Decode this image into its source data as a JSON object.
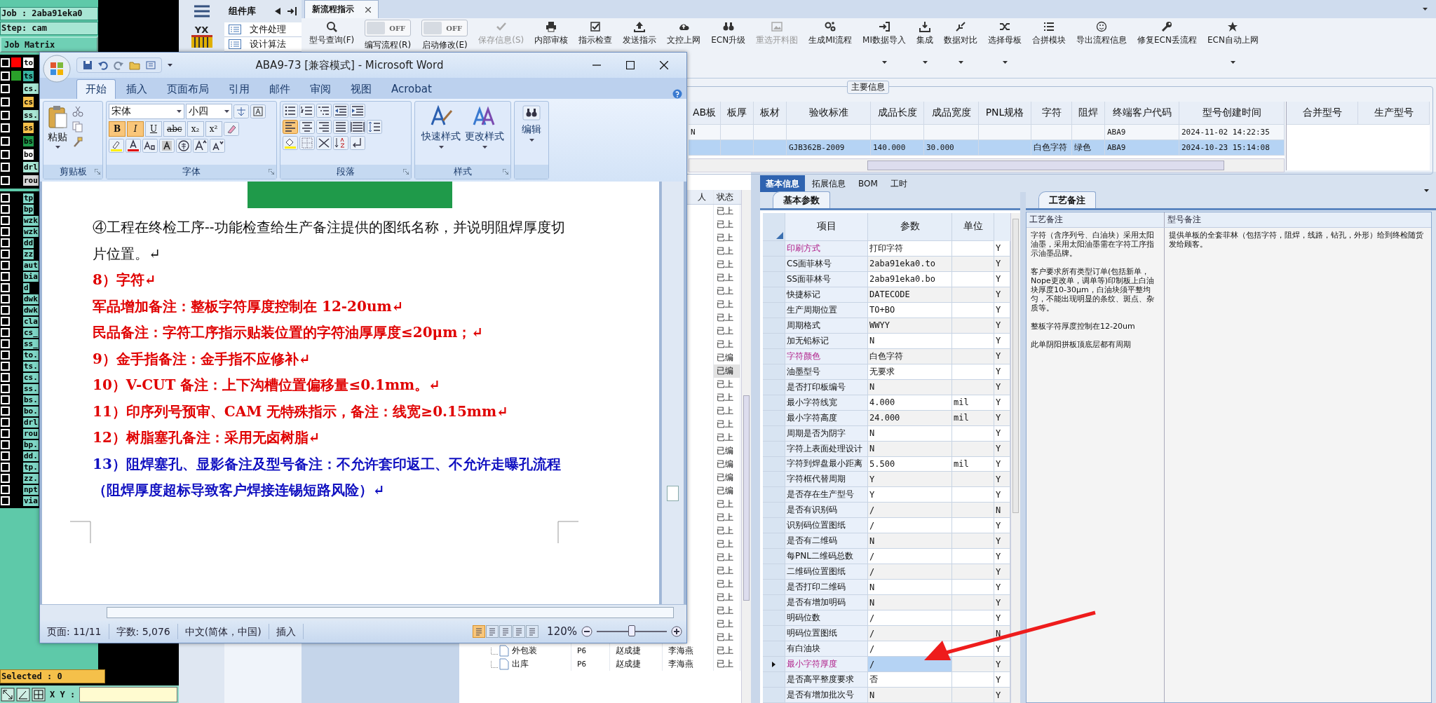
{
  "cam_panel": {
    "job": "Job : 2aba91eka0",
    "step": "Step: cam",
    "matrix_button": "Job Matrix",
    "layers": [
      {
        "name": "to",
        "color": "#ffffff",
        "checked": false,
        "marker": {
          "color": "#ff0000"
        }
      },
      {
        "name": "ts",
        "color": "#36b3a0",
        "checked": false,
        "marker": {
          "color": "#2aa02a"
        }
      },
      {
        "name": "cs.",
        "color": "#a8e6d4",
        "checked": false
      },
      {
        "name": "cs",
        "color": "#f5c04a",
        "checked": false
      },
      {
        "name": "ss.",
        "color": "#a8e6d4",
        "checked": false
      },
      {
        "name": "ss",
        "color": "#f5c04a",
        "checked": false
      },
      {
        "name": "bs",
        "color": "#1f9a4a",
        "checked": false
      },
      {
        "name": "bo",
        "color": "#ffffff",
        "checked": false
      },
      {
        "name": "drl",
        "color": "#a8e6d4",
        "checked": false
      },
      {
        "name": "rou",
        "color": "#d8d8d8",
        "checked": false
      }
    ],
    "layers_lower": [
      {
        "name": "tp",
        "checked": false
      },
      {
        "name": "bp",
        "checked": false
      },
      {
        "name": "wzk",
        "checked": false
      },
      {
        "name": "wzk",
        "checked": false
      },
      {
        "name": "dd",
        "checked": false
      },
      {
        "name": "zz",
        "checked": false
      },
      {
        "name": "aut",
        "checked": false
      },
      {
        "name": "bia",
        "checked": false
      },
      {
        "name": "d",
        "checked": false
      },
      {
        "name": "dwk",
        "checked": false
      },
      {
        "name": "dwk",
        "checked": false
      },
      {
        "name": "cla",
        "checked": false
      },
      {
        "name": "cs_",
        "checked": false
      },
      {
        "name": "ss_",
        "checked": false
      },
      {
        "name": "to.",
        "checked": false
      },
      {
        "name": "ts.",
        "checked": false
      },
      {
        "name": "cs.",
        "checked": false
      },
      {
        "name": "ss.",
        "checked": false
      },
      {
        "name": "bs.",
        "checked": false
      },
      {
        "name": "bo.",
        "checked": false
      },
      {
        "name": "drl",
        "checked": false
      },
      {
        "name": "rou",
        "checked": false
      },
      {
        "name": "bp.",
        "checked": false
      },
      {
        "name": "dd.",
        "checked": false
      },
      {
        "name": "tp.",
        "checked": false
      },
      {
        "name": "zz.",
        "checked": false
      },
      {
        "name": "npt",
        "checked": false
      },
      {
        "name": "via",
        "checked": false
      }
    ],
    "selected_label": "Selected : 0",
    "xy_label": "X Y :"
  },
  "sidebar": {
    "logo_text": "YX",
    "title": "组件库",
    "items": [
      "文件处理",
      "设计算法"
    ]
  },
  "tabs": [
    {
      "label": "新流程指示",
      "selected": true
    }
  ],
  "toolbar": [
    {
      "kind": "button",
      "label": "型号查询(F)",
      "disabled": false,
      "dropdown": false
    },
    {
      "kind": "toggle",
      "label": "编写流程(R)",
      "state": "OFF",
      "on": false
    },
    {
      "kind": "toggle",
      "label": "启动修改(E)",
      "state": "OFF",
      "on": false
    },
    {
      "kind": "button",
      "label": "保存信息(S)",
      "disabled": true,
      "dropdown": false
    },
    {
      "kind": "button",
      "label": "内部审核",
      "disabled": false,
      "dropdown": false
    },
    {
      "kind": "button",
      "label": "指示检查",
      "disabled": false,
      "dropdown": false
    },
    {
      "kind": "button",
      "label": "发送指示",
      "disabled": false,
      "dropdown": false
    },
    {
      "kind": "button",
      "label": "文控上网",
      "disabled": false,
      "dropdown": false
    },
    {
      "kind": "button",
      "label": "ECN升级",
      "disabled": false,
      "dropdown": false
    },
    {
      "kind": "button",
      "label": "重选开料图",
      "disabled": true,
      "dropdown": false
    },
    {
      "kind": "button",
      "label": "生成MI流程",
      "disabled": false,
      "dropdown": false
    },
    {
      "kind": "button",
      "label": "MI数据导入",
      "disabled": false,
      "dropdown": true
    },
    {
      "kind": "button",
      "label": "集成",
      "disabled": false,
      "dropdown": true
    },
    {
      "kind": "button",
      "label": "数据对比",
      "disabled": false,
      "dropdown": true
    },
    {
      "kind": "button",
      "label": "选择母板",
      "disabled": false,
      "dropdown": true
    },
    {
      "kind": "button",
      "label": "合拼模块",
      "disabled": false,
      "dropdown": false
    },
    {
      "kind": "button",
      "label": "导出流程信息",
      "disabled": false,
      "dropdown": false
    },
    {
      "kind": "button",
      "label": "修复ECN丢流程",
      "disabled": false,
      "dropdown": false
    },
    {
      "kind": "button",
      "label": "ECN自动上网",
      "disabled": false,
      "dropdown": true
    }
  ],
  "main_info": {
    "title": "主要信息",
    "columns": [
      "AB板",
      "板厚",
      "板材",
      "验收标准",
      "成品长度",
      "成品宽度",
      "PNL规格",
      "字符",
      "阻焊",
      "终端客户代码",
      "型号创建时间"
    ],
    "rows": [
      {
        "selected": false,
        "cells": [
          "N",
          "",
          "",
          "",
          "",
          "",
          "",
          "",
          "",
          "ABA9",
          "2024-11-02 14:22:35"
        ]
      },
      {
        "selected": true,
        "cells": [
          "",
          "",
          "",
          "GJB362B-2009",
          "140.000",
          "30.000",
          "",
          "白色字符",
          "绿色",
          "ABA9",
          "2024-10-23 15:14:08"
        ]
      }
    ],
    "side_columns": [
      "合并型号",
      "生产型号"
    ]
  },
  "flow_list": {
    "person_header": "人",
    "status_header": "状态",
    "rows": [
      {
        "status": "已上",
        "selected": false
      },
      {
        "status": "已上",
        "selected": false
      },
      {
        "status": "已上",
        "selected": false
      },
      {
        "status": "已上",
        "selected": false
      },
      {
        "status": "已上",
        "selected": false
      },
      {
        "status": "已上",
        "selected": false
      },
      {
        "status": "已上",
        "selected": false
      },
      {
        "status": "已上",
        "selected": false
      },
      {
        "status": "已上",
        "selected": false
      },
      {
        "status": "已上",
        "selected": false
      },
      {
        "status": "已上",
        "selected": false
      },
      {
        "status": "已编",
        "selected": false
      },
      {
        "status": "已编",
        "selected": true
      },
      {
        "status": "已上",
        "selected": false
      },
      {
        "status": "已上",
        "selected": false
      },
      {
        "status": "已上",
        "selected": false
      },
      {
        "status": "已上",
        "selected": false
      },
      {
        "status": "已上",
        "selected": false
      },
      {
        "status": "已编",
        "selected": false
      },
      {
        "status": "已编",
        "selected": false
      },
      {
        "status": "已编",
        "selected": false
      },
      {
        "status": "已编",
        "selected": false
      },
      {
        "status": "已上",
        "selected": false
      },
      {
        "status": "已上",
        "selected": false
      },
      {
        "status": "已上",
        "selected": false
      },
      {
        "status": "已上",
        "selected": false
      },
      {
        "status": "已上",
        "selected": false
      },
      {
        "status": "已上",
        "selected": false
      },
      {
        "status": "已上",
        "selected": false
      },
      {
        "status": "已上",
        "selected": false
      },
      {
        "status": "已上",
        "selected": false
      },
      {
        "status": "已上",
        "selected": false
      },
      {
        "status": "已上",
        "selected": false
      },
      {
        "name": "外包装",
        "code": "P6",
        "person1": "赵成捷",
        "person2": "李海燕",
        "status": "已上",
        "selected": false
      },
      {
        "name": "出库",
        "code": "P6",
        "person1": "赵成捷",
        "person2": "李海燕",
        "status": "已上",
        "selected": false
      }
    ]
  },
  "detail_tabs": [
    {
      "label": "基本信息",
      "selected": true
    },
    {
      "label": "拓展信息",
      "selected": false
    },
    {
      "label": "BOM",
      "selected": false
    },
    {
      "label": "工时",
      "selected": false
    }
  ],
  "params": {
    "tab": "基本参数",
    "columns": [
      "项目",
      "参数",
      "单位"
    ],
    "rows": [
      {
        "item": "印刷方式",
        "value": "打印字符",
        "unit": "",
        "flag": "Y",
        "highlight": true,
        "current": false
      },
      {
        "item": "CS面菲林号",
        "value": "2aba91eka0.to",
        "unit": "",
        "flag": "Y",
        "highlight": false,
        "current": false
      },
      {
        "item": "SS面菲林号",
        "value": "2aba91eka0.bo",
        "unit": "",
        "flag": "Y",
        "highlight": false,
        "current": false
      },
      {
        "item": "快捷标记",
        "value": "DATECODE",
        "unit": "",
        "flag": "Y",
        "highlight": false,
        "current": false
      },
      {
        "item": "生产周期位置",
        "value": "TO+BO",
        "unit": "",
        "flag": "Y",
        "highlight": false,
        "current": false
      },
      {
        "item": "周期格式",
        "value": "WWYY",
        "unit": "",
        "flag": "Y",
        "highlight": false,
        "current": false
      },
      {
        "item": "加无铅标记",
        "value": "N",
        "unit": "",
        "flag": "Y",
        "highlight": false,
        "current": false
      },
      {
        "item": "字符颜色",
        "value": "白色字符",
        "unit": "",
        "flag": "Y",
        "highlight": true,
        "current": false
      },
      {
        "item": "油墨型号",
        "value": "无要求",
        "unit": "",
        "flag": "Y",
        "highlight": false,
        "current": false
      },
      {
        "item": "是否打印板编号",
        "value": "N",
        "unit": "",
        "flag": "Y",
        "highlight": false,
        "current": false
      },
      {
        "item": "最小字符线宽",
        "value": "4.000",
        "unit": "mil",
        "flag": "Y",
        "highlight": false,
        "current": false
      },
      {
        "item": "最小字符高度",
        "value": "24.000",
        "unit": "mil",
        "flag": "Y",
        "highlight": false,
        "current": false
      },
      {
        "item": "周期是否为阴字",
        "value": "N",
        "unit": "",
        "flag": "Y",
        "highlight": false,
        "current": false
      },
      {
        "item": "字符上表面处理设计",
        "value": "N",
        "unit": "",
        "flag": "Y",
        "highlight": false,
        "current": false
      },
      {
        "item": "字符到焊盘最小距离",
        "value": "5.500",
        "unit": "mil",
        "flag": "Y",
        "highlight": false,
        "current": false
      },
      {
        "item": "字符框代替周期",
        "value": "Y",
        "unit": "",
        "flag": "Y",
        "highlight": false,
        "current": false
      },
      {
        "item": "是否存在生产型号",
        "value": "Y",
        "unit": "",
        "flag": "Y",
        "highlight": false,
        "current": false
      },
      {
        "item": "是否有识别码",
        "value": "/",
        "unit": "",
        "flag": "N",
        "highlight": false,
        "current": false
      },
      {
        "item": "识别码位置图纸",
        "value": "/",
        "unit": "",
        "flag": "Y",
        "highlight": false,
        "current": false
      },
      {
        "item": "是否有二维码",
        "value": "N",
        "unit": "",
        "flag": "Y",
        "highlight": false,
        "current": false
      },
      {
        "item": "每PNL二维码总数",
        "value": "/",
        "unit": "",
        "flag": "Y",
        "highlight": false,
        "current": false
      },
      {
        "item": "二维码位置图纸",
        "value": "/",
        "unit": "",
        "flag": "Y",
        "highlight": false,
        "current": false
      },
      {
        "item": "是否打印二维码",
        "value": "N",
        "unit": "",
        "flag": "Y",
        "highlight": false,
        "current": false
      },
      {
        "item": "是否有增加明码",
        "value": "N",
        "unit": "",
        "flag": "Y",
        "highlight": false,
        "current": false
      },
      {
        "item": "明码位数",
        "value": "/",
        "unit": "",
        "flag": "Y",
        "highlight": false,
        "current": false
      },
      {
        "item": "明码位置图纸",
        "value": "/",
        "unit": "",
        "flag": "N",
        "highlight": false,
        "current": false
      },
      {
        "item": "有白油块",
        "value": "/",
        "unit": "",
        "flag": "Y",
        "highlight": false,
        "current": false
      },
      {
        "item": "最小字符厚度",
        "value": "/",
        "unit": "",
        "flag": "Y",
        "highlight": true,
        "current": true
      },
      {
        "item": "是否高平整度要求",
        "value": "否",
        "unit": "",
        "flag": "Y",
        "highlight": false,
        "current": false
      },
      {
        "item": "是否有增加批次号",
        "value": "N",
        "unit": "",
        "flag": "Y",
        "highlight": false,
        "current": false
      }
    ]
  },
  "notes": {
    "tab": "工艺备注",
    "columns": [
      "工艺备注",
      "型号备注"
    ],
    "process_notes": [
      "字符（含序列号、白油块）采用太阳油墨，采用太阳油墨需在字符工序指示油墨品牌。",
      "客户要求所有类型订单(包括新单，Nope更改单，调单等)印制板上白油块厚度10-30μm，白油块须平整均匀，不能出现明显的条纹、斑点、杂质等。",
      "整板字符厚度控制在12-20um",
      "此单阴阳拼板顶底层都有周期"
    ],
    "model_notes": [
      "提供单板的全套菲林（包括字符，阻焊，线路，钻孔，外形）给到终检随货发给顾客。"
    ]
  },
  "word": {
    "title": "ABA9-73 [兼容模式] - Microsoft Word",
    "tabs": [
      {
        "label": "开始",
        "selected": true
      },
      {
        "label": "插入",
        "selected": false
      },
      {
        "label": "页面布局",
        "selected": false
      },
      {
        "label": "引用",
        "selected": false
      },
      {
        "label": "邮件",
        "selected": false
      },
      {
        "label": "审阅",
        "selected": false
      },
      {
        "label": "视图",
        "selected": false
      },
      {
        "label": "Acrobat",
        "selected": false
      }
    ],
    "paste": "粘贴",
    "font_name": "宋体",
    "font_size": "小四",
    "format_buttons": [
      {
        "label": "B",
        "selected": true
      },
      {
        "label": "I",
        "selected": true
      },
      {
        "label": "U",
        "selected": false
      },
      {
        "label": "abc",
        "selected": false
      },
      {
        "label": "x₂",
        "selected": false
      },
      {
        "label": "x²",
        "selected": false
      }
    ],
    "groups": [
      "剪贴板",
      "字体",
      "段落",
      "样式"
    ],
    "style_buttons": [
      "快速样式",
      "更改样式"
    ],
    "edit": "编辑",
    "paragraphs": [
      {
        "kind": "normal",
        "text": "④工程在终检工序--功能检查给生产备注提供的图纸名称，并说明阻焊厚度切片位置。↵"
      },
      {
        "kind": "red",
        "text": "8）字符↵"
      },
      {
        "kind": "red",
        "text": "军品增加备注：整板字符厚度控制在 12-20um↵"
      },
      {
        "kind": "red",
        "text": "民品备注：字符工序指示贴装位置的字符油厚厚度≤20μm；↵"
      },
      {
        "kind": "red",
        "text": "9）金手指备注：金手指不应修补↵"
      },
      {
        "kind": "red",
        "text": "10）V-CUT 备注：上下沟槽位置偏移量≤0.1mm。↵"
      },
      {
        "kind": "red",
        "text": "11）印序列号预审、CAM 无特殊指示，备注：线宽≥0.15mm↵"
      },
      {
        "kind": "red",
        "text": "12）树脂塞孔备注：采用无卤树脂↵"
      },
      {
        "kind": "blue",
        "text": "13）阻焊塞孔、显影备注及型号备注：不允许套印返工、不允许走曝孔流程（阻焊厚度超标导致客户焊接连锡短路风险）↵"
      }
    ],
    "status": [
      "页面: 11/11",
      "字数: 5,076",
      "中文(简体，中国)",
      "插入"
    ],
    "zoom": "120%",
    "zoom_slider": {
      "level": 0.5
    }
  }
}
